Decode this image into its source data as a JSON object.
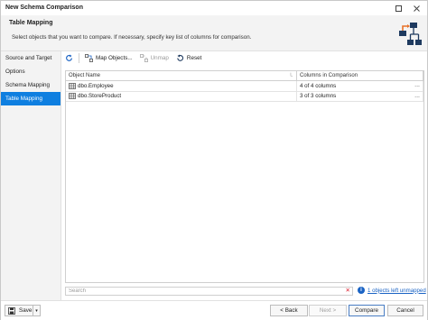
{
  "window": {
    "title": "New Schema Comparison",
    "maximize_icon": "square-icon",
    "close_icon": "close-icon"
  },
  "header": {
    "title": "Table Mapping",
    "subtitle": "Select objects that you want to compare. If necessary, specify key list of columns for comparison.",
    "icon": "schema-diagram-icon"
  },
  "nav": {
    "items": [
      {
        "label": "Source and Target",
        "active": false
      },
      {
        "label": "Options",
        "active": false
      },
      {
        "label": "Schema Mapping",
        "active": false
      },
      {
        "label": "Table Mapping",
        "active": true
      }
    ]
  },
  "toolbar": {
    "refresh_icon": "refresh-icon",
    "map_objects_label": "Map Objects...",
    "unmap_label": "Unmap",
    "reset_label": "Reset"
  },
  "grid": {
    "columns": [
      "Object Name",
      "Columns in Comparison"
    ],
    "rows": [
      {
        "object": "dbo.Employee",
        "columns": "4 of 4 columns",
        "more": "..."
      },
      {
        "object": "dbo.StoreProduct",
        "columns": "3 of 3 columns",
        "more": "..."
      }
    ]
  },
  "search": {
    "placeholder": "Search",
    "value": ""
  },
  "status": {
    "unmapped_label": "1 objects left unmapped"
  },
  "footer": {
    "save_label": "Save",
    "back_label": "< Back",
    "next_label": "Next >",
    "compare_label": "Compare",
    "cancel_label": "Cancel"
  },
  "colors": {
    "accent": "#0f7fe0",
    "link": "#1a63c4"
  }
}
